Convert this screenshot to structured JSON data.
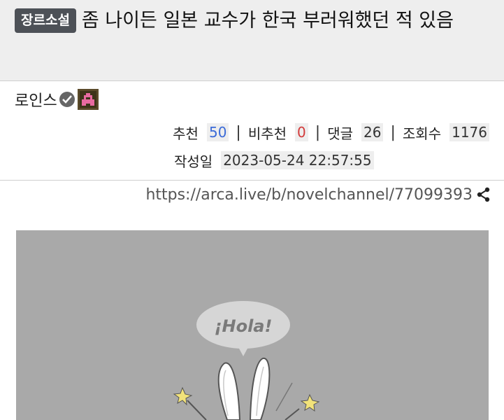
{
  "post": {
    "category": "장르소설",
    "title": "좀 나이든 일본 교수가 한국 부러워했던 적 있음"
  },
  "author": {
    "name": "로인스",
    "verified_icon": "verified-check-icon",
    "avatar_icon": "pixel-avatar-icon"
  },
  "stats": {
    "recommend_label": "추천",
    "recommend_value": "50",
    "unrecommend_label": "비추천",
    "unrecommend_value": "0",
    "comments_label": "댓글",
    "comments_value": "26",
    "views_label": "조회수",
    "views_value": "1176",
    "separator": "|"
  },
  "date": {
    "label": "작성일",
    "value": "2023-05-24 22:57:55"
  },
  "link": {
    "url": "https://arca.live/b/novelchannel/77099393",
    "share_icon": "share-icon"
  },
  "image": {
    "speech_bubble_text": "¡Hola!"
  },
  "colors": {
    "title_bg": "#eeeeee",
    "badge_bg": "#4d5157",
    "recommend": "#3b6bd8",
    "unrecommend": "#d33b3b",
    "image_bg": "#a9a9a9"
  }
}
